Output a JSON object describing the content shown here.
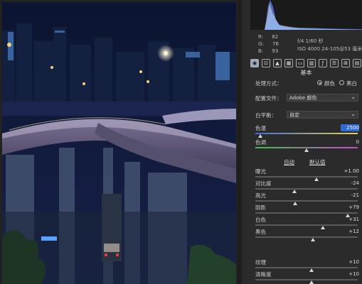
{
  "readouts": {
    "r_label": "R:",
    "r_value": "82",
    "g_label": "G:",
    "g_value": "76",
    "b_label": "B:",
    "b_value": "93",
    "aperture_shutter": "f/4  1/60 秒",
    "iso_lens": "ISO 4000  24-105@53 毫米"
  },
  "section": {
    "title": "基本"
  },
  "treatment": {
    "label": "处理方式：",
    "color_label": "颜色",
    "bw_label": "黑白",
    "selected": "color"
  },
  "profile": {
    "label": "配置文件：",
    "value": "Adobe 颜色"
  },
  "white_balance": {
    "label": "白平衡：",
    "value": "自定"
  },
  "sliders_wb": [
    {
      "label": "色温",
      "value": "2500",
      "level": 0.05,
      "active": true
    },
    {
      "label": "色调",
      "value": "0",
      "level": 0.5
    }
  ],
  "tone_header": {
    "auto": "自动",
    "default": "默认值"
  },
  "sliders_tone": [
    {
      "label": "曝光",
      "value": "+1.00",
      "level": 0.6
    },
    {
      "label": "对比度",
      "value": "-24",
      "level": 0.38
    },
    {
      "label": "高光",
      "value": "-21",
      "level": 0.39
    },
    {
      "label": "阴影",
      "value": "+79",
      "level": 0.9
    },
    {
      "label": "白色",
      "value": "+31",
      "level": 0.66
    },
    {
      "label": "黑色",
      "value": "+12",
      "level": 0.56
    }
  ],
  "sliders_presence": [
    {
      "label": "纹理",
      "value": "+10",
      "level": 0.55
    },
    {
      "label": "清晰度",
      "value": "+10",
      "level": 0.55
    }
  ],
  "colors": {
    "accent": "#2f6bd8"
  }
}
